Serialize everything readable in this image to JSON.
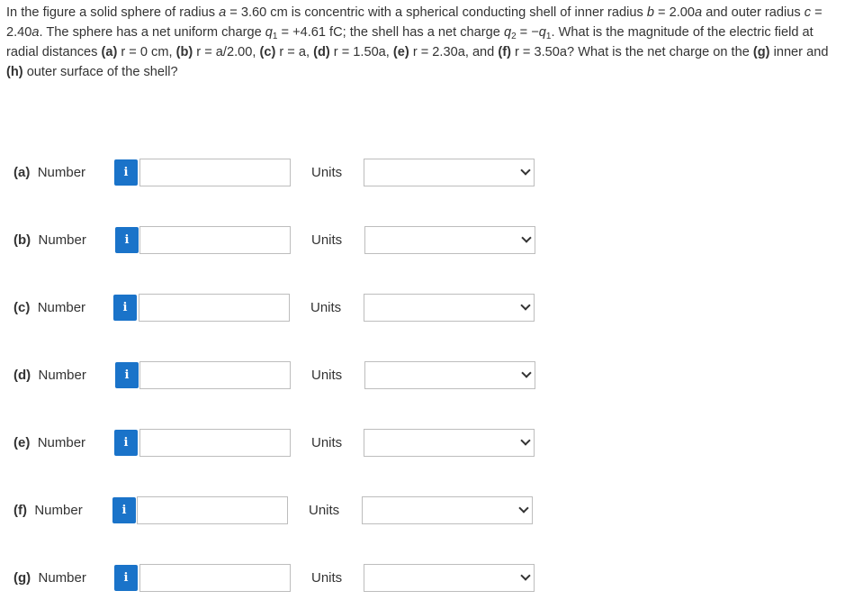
{
  "problem": {
    "t1": "In the figure a solid sphere of radius ",
    "a_var": "a",
    "t2": " = 3.60 cm is concentric with a spherical conducting shell of inner radius ",
    "b_var": "b",
    "t3": " = 2.00",
    "a_var2": "a",
    "t4": " and outer radius ",
    "c_var": "c",
    "t5": " = 2.40",
    "a_var3": "a",
    "t6": ". The sphere has a net uniform charge ",
    "q_var1": "q",
    "q_sub1": "1",
    "t7": " = +4.61 fC; the shell has a net charge ",
    "q_var2": "q",
    "q_sub2": "2",
    "t8": " = −",
    "q_var3": "q",
    "q_sub3": "1",
    "t9": ". What is the magnitude of the electric field at radial distances ",
    "pa": "(a)",
    "ra": " r = 0 cm, ",
    "pb": "(b)",
    "rb": " r = a/2.00, ",
    "pc": "(c)",
    "rc": " r = a, ",
    "pd": "(d)",
    "rd": " r = 1.50a, ",
    "pe": "(e)",
    "re": " r = 2.30a, and ",
    "pf": "(f)",
    "rf": " r = 3.50a? What is the net charge on the ",
    "pg": "(g)",
    "rg": " inner and ",
    "ph": "(h)",
    "rh": " outer surface of the shell?"
  },
  "rows": [
    {
      "part": "(a)",
      "label": "Number",
      "info": "i",
      "units": "Units",
      "value": ""
    },
    {
      "part": "(b)",
      "label": "Number",
      "info": "i",
      "units": "Units",
      "value": ""
    },
    {
      "part": "(c)",
      "label": "Number",
      "info": "i",
      "units": "Units",
      "value": ""
    },
    {
      "part": "(d)",
      "label": "Number",
      "info": "i",
      "units": "Units",
      "value": ""
    },
    {
      "part": "(e)",
      "label": "Number",
      "info": "i",
      "units": "Units",
      "value": ""
    },
    {
      "part": "(f)",
      "label": "Number",
      "info": "i",
      "units": "Units",
      "value": ""
    },
    {
      "part": "(g)",
      "label": "Number",
      "info": "i",
      "units": "Units",
      "value": ""
    }
  ],
  "icons": {
    "info": "info-icon",
    "dropdown": "chevron-down-icon"
  },
  "colors": {
    "info_button": "#1a73c9",
    "border": "#bdbdbd"
  }
}
